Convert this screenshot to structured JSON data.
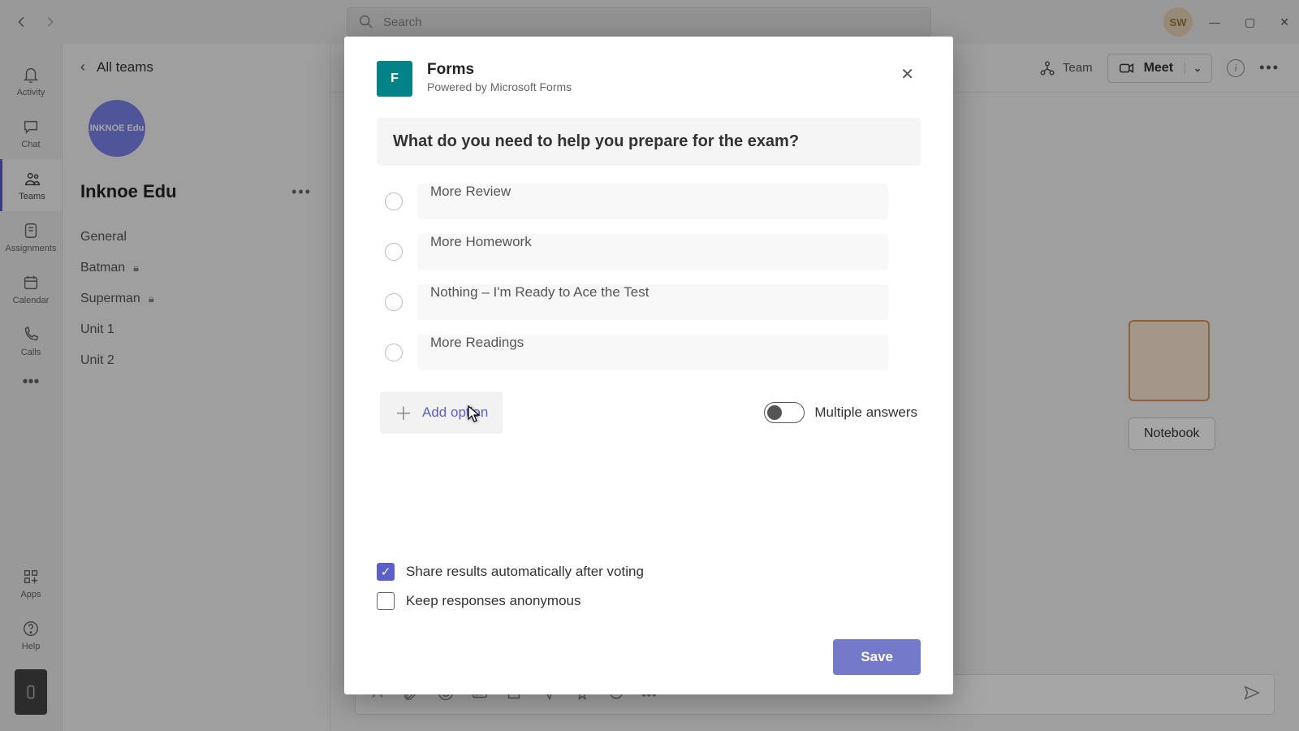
{
  "titlebar": {
    "search_placeholder": "Search",
    "avatar_initials": "SW"
  },
  "rail": {
    "activity": "Activity",
    "chat": "Chat",
    "teams": "Teams",
    "assignments": "Assignments",
    "calendar": "Calendar",
    "calls": "Calls",
    "apps": "Apps",
    "help": "Help"
  },
  "sidebar": {
    "all_teams": "All teams",
    "team_logo_text": "INKNOE\nEdu",
    "team_name": "Inknoe Edu",
    "channels": [
      {
        "label": "General",
        "locked": false
      },
      {
        "label": "Batman",
        "locked": true
      },
      {
        "label": "Superman",
        "locked": true
      },
      {
        "label": "Unit 1",
        "locked": false
      },
      {
        "label": "Unit 2",
        "locked": false
      }
    ]
  },
  "channel_header": {
    "team_label": "Team",
    "meet_label": "Meet"
  },
  "content": {
    "notebook": "Notebook"
  },
  "modal": {
    "app_title": "Forms",
    "app_subtitle": "Powered by Microsoft Forms",
    "question": "What do you need to help you prepare for the exam?",
    "options": [
      "More Review",
      "More Homework",
      "Nothing – I'm Ready to Ace the Test",
      "More Readings"
    ],
    "add_option": "Add option",
    "multiple_answers": "Multiple answers",
    "share_results": "Share results automatically after voting",
    "anon": "Keep responses anonymous",
    "save": "Save"
  }
}
